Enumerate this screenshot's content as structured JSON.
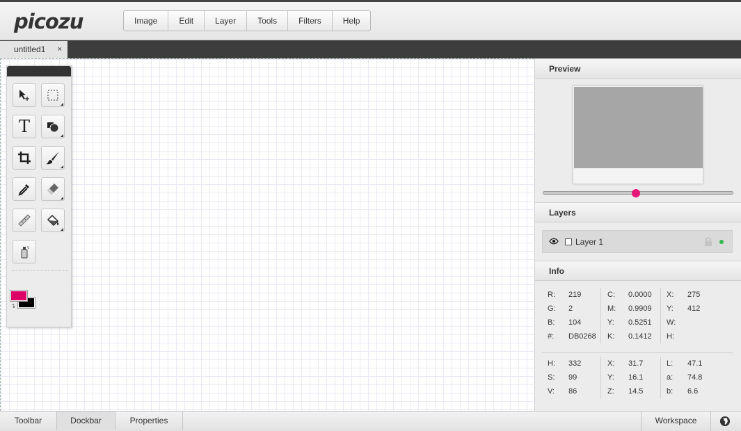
{
  "app": {
    "logo_text": "picozu"
  },
  "menu": [
    "Image",
    "Edit",
    "Layer",
    "Tools",
    "Filters",
    "Help"
  ],
  "document_tab": {
    "title": "untitled1",
    "close_label": "×"
  },
  "toolbox": {
    "tools": [
      {
        "name": "move-tool",
        "icon": "move-arrow-icon"
      },
      {
        "name": "marquee-select-tool",
        "icon": "dotted-rectangle-icon"
      },
      {
        "name": "text-tool",
        "icon": "text-t-icon",
        "glyph": "T"
      },
      {
        "name": "shape-tool",
        "icon": "shapes-icon"
      },
      {
        "name": "crop-tool",
        "icon": "crop-icon"
      },
      {
        "name": "brush-tool",
        "icon": "brush-icon"
      },
      {
        "name": "eyedropper-tool",
        "icon": "eyedropper-icon"
      },
      {
        "name": "eraser-tool",
        "icon": "eraser-icon"
      },
      {
        "name": "ruler-tool",
        "icon": "ruler-icon"
      },
      {
        "name": "fill-tool",
        "icon": "paint-bucket-icon"
      },
      {
        "name": "spray-tool",
        "icon": "spray-can-icon"
      }
    ],
    "foreground_color": "#DB0268",
    "background_color": "#000000"
  },
  "preview": {
    "title": "Preview",
    "zoom_fraction": 0.49,
    "knob_color": "#e5177a"
  },
  "layers": {
    "title": "Layers",
    "items": [
      {
        "name": "Layer 1",
        "status_color": "#2db84d"
      }
    ]
  },
  "info": {
    "title": "Info",
    "rgb": [
      {
        "k": "R:",
        "v": "219"
      },
      {
        "k": "G:",
        "v": "2"
      },
      {
        "k": "B:",
        "v": "104"
      },
      {
        "k": "#:",
        "v": "DB0268"
      }
    ],
    "cmyk": [
      {
        "k": "C:",
        "v": "0.0000"
      },
      {
        "k": "M:",
        "v": "0.9909"
      },
      {
        "k": "Y:",
        "v": "0.5251"
      },
      {
        "k": "K:",
        "v": "0.1412"
      }
    ],
    "pos": [
      {
        "k": "X:",
        "v": "275"
      },
      {
        "k": "Y:",
        "v": "412"
      },
      {
        "k": "W:",
        "v": ""
      },
      {
        "k": "H:",
        "v": ""
      }
    ],
    "hsv": [
      {
        "k": "H:",
        "v": "332"
      },
      {
        "k": "S:",
        "v": "99"
      },
      {
        "k": "V:",
        "v": "86"
      }
    ],
    "xyz": [
      {
        "k": "X:",
        "v": "31.7"
      },
      {
        "k": "Y:",
        "v": "16.1"
      },
      {
        "k": "Z:",
        "v": "14.5"
      }
    ],
    "lab": [
      {
        "k": "L:",
        "v": "47.1"
      },
      {
        "k": "a:",
        "v": "74.8"
      },
      {
        "k": "b:",
        "v": "6.6"
      }
    ]
  },
  "bottombar": {
    "left_buttons": [
      "Toolbar",
      "Dockbar",
      "Properties"
    ],
    "active": "Dockbar",
    "workspace_label": "Workspace"
  }
}
